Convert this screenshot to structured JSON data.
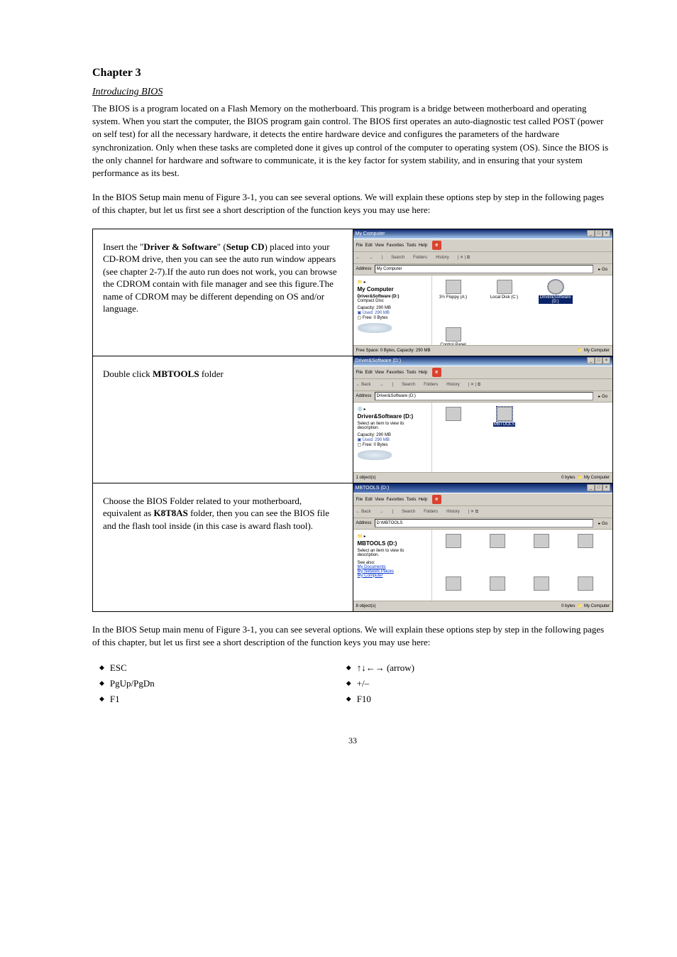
{
  "chapter": "Chapter 3",
  "section_title": "Introducing BIOS",
  "intro_p1": "The BIOS is a program located on a Flash Memory on the motherboard. This program is a bridge between motherboard and operating system. When you start the computer, the BIOS program gain control. The BIOS first operates an auto-diagnostic test called POST (power on self test) for all the necessary hardware, it detects the entire hardware device and configures the parameters of the hardware synchronization. Only when these tasks are completed done it gives up control of the computer to operating system (OS). Since the BIOS is the only channel for hardware and software to communicate, it is the key factor for system stability, and in ensuring that your system performance as its best.",
  "intro_p2": "In the BIOS Setup main menu of Figure 3-1, you can see several options. We will explain these options step by step in the following pages of this chapter, but let us first see a short description of the function keys you may use here:",
  "table": {
    "r1": {
      "text_pre": "Insert the \"",
      "b1": "Driver & Software",
      "text_mid": "\" (",
      "b2": "Setup CD",
      "text_post": ") placed into your CD-ROM drive, then you can see the auto run window appears (see chapter 2-7).If the auto run does not work, you can browse the CDROM contain with file manager and see this figure.The name of CDROM may be different depending on OS and/or language.",
      "shot": {
        "title": "My Computer",
        "menu": [
          "File",
          "Edit",
          "View",
          "Favorites",
          "Tools",
          "Help"
        ],
        "go_icon_sr": "go",
        "toolbar": [
          "Search",
          "Folders",
          "History"
        ],
        "addr_label": "Address",
        "addr_value": "My Computer",
        "gobtn": "Go",
        "left_hd": "My Computer",
        "left_sel_line1": "Driver&Software (D:)",
        "left_sel_line2": "Compact Disc",
        "left_cap": "Capacity: 290 MB",
        "left_used": "Used: 290 MB",
        "left_free": "Free: 0 Bytes",
        "icons": [
          {
            "label": "3½ Floppy (A:)",
            "cls": ""
          },
          {
            "label": "Local Disk (C:)",
            "cls": "drivepic"
          },
          {
            "label": "Driver&Software (D:)",
            "cls": "cdpic",
            "sel": true
          },
          {
            "label": "Control Panel",
            "cls": "panelpic"
          }
        ],
        "status_left": "Free Space: 0 Bytes, Capacity: 290 MB",
        "status_right": "My Computer"
      }
    },
    "r2": {
      "text_pre": "Double click ",
      "b1": "MBTOOLS",
      "text_post": " folder",
      "shot": {
        "title": "Driver&Software (D:)",
        "menu": [
          "File",
          "Edit",
          "View",
          "Favorites",
          "Tools",
          "Help"
        ],
        "toolbar_back": "Back",
        "toolbar": [
          "Search",
          "Folders",
          "History"
        ],
        "addr_label": "Address",
        "addr_value": "Driver&Software (D:)",
        "gobtn": "Go",
        "left_hd": "Driver&Software (D:)",
        "left_tip": "Select an item to view its description.",
        "left_cap": "Capacity: 290 MB",
        "left_used": "Used: 290 MB",
        "left_free": "Free: 0 Bytes",
        "icons": [
          {
            "label": "",
            "cls": ""
          },
          {
            "label": "MBTOOLS",
            "cls": "folderpic",
            "sel": true
          }
        ],
        "status_left": "1 object(s)",
        "status_mid": "0 bytes",
        "status_right": "My Computer"
      }
    },
    "r3": {
      "text_pre": "Choose the BIOS Folder related to your motherboard, equivalent as ",
      "b1": "K8T8AS",
      "text_post": " folder, then you can see the BIOS file and the flash tool inside (in this case is award flash tool).",
      "shot": {
        "title": "MBTOOLS (D:)",
        "menu": [
          "File",
          "Edit",
          "View",
          "Favorites",
          "Tools",
          "Help"
        ],
        "toolbar_back": "Back",
        "toolbar": [
          "Search",
          "Folders",
          "History"
        ],
        "addr_label": "Address",
        "addr_value": "D:\\MBTOOLS",
        "gobtn": "Go",
        "left_hd": "MBTOOLS (D:)",
        "left_tip": "Select an item to view its description.",
        "links_hdr": "See also:",
        "links": [
          "My Documents",
          "My Network Places",
          "My Computer"
        ],
        "folders": [
          "",
          "",
          "",
          "",
          "",
          "",
          "",
          ""
        ],
        "status_left": "8 object(s)",
        "status_mid": "0 bytes",
        "status_right": "My Computer"
      }
    }
  },
  "func_keys_intro": "In the BIOS Setup main menu of Figure 3-1, you can see several options. We will explain these options step by step in the following pages of this chapter, but let us first see a short description of the function keys you may use here:",
  "bullets_left": [
    "ESC",
    "PgUp/PgDn",
    "F1"
  ],
  "bullets_right": [
    "↑↓←→ (arrow)",
    "+/–",
    "F10"
  ],
  "page_no": "33"
}
